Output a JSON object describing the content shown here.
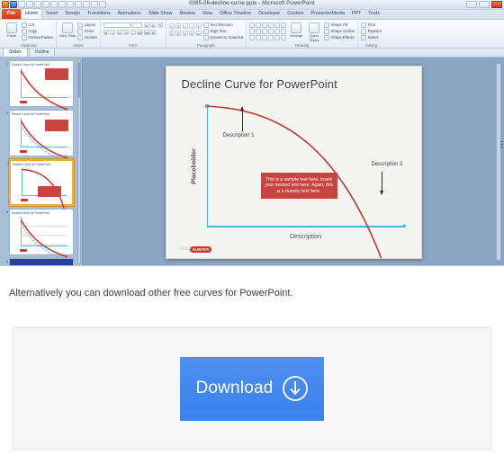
{
  "app": {
    "title": "0085-06-decline-curve.pptx - Microsoft PowerPoint",
    "quick_access": [
      "save-icon",
      "undo-icon",
      "redo-icon",
      "new-icon",
      "open-icon",
      "print-icon",
      "customize-icon"
    ],
    "window_buttons": [
      "minimize-button",
      "restore-button",
      "close-button"
    ]
  },
  "ribbon": {
    "tabs": [
      {
        "label": "File",
        "type": "file"
      },
      {
        "label": "Home",
        "type": "active"
      },
      {
        "label": "Insert",
        "type": "normal"
      },
      {
        "label": "Design",
        "type": "normal"
      },
      {
        "label": "Transitions",
        "type": "normal"
      },
      {
        "label": "Animations",
        "type": "normal"
      },
      {
        "label": "Slide Show",
        "type": "normal"
      },
      {
        "label": "Review",
        "type": "normal"
      },
      {
        "label": "View",
        "type": "normal"
      },
      {
        "label": "Office Timeline",
        "type": "normal"
      },
      {
        "label": "Developer",
        "type": "normal"
      },
      {
        "label": "Custom",
        "type": "normal"
      },
      {
        "label": "PresenterMedia",
        "type": "normal"
      },
      {
        "label": "PPT",
        "type": "normal"
      },
      {
        "label": "Tools",
        "type": "normal"
      }
    ],
    "groups": {
      "clipboard": {
        "label": "Clipboard",
        "paste": "Paste",
        "items": [
          "Cut",
          "Copy",
          "Format Painter"
        ]
      },
      "slides": {
        "label": "Slides",
        "new_slide": "New Slide",
        "items": [
          "Layout",
          "Reset",
          "Section"
        ]
      },
      "font": {
        "label": "Font",
        "font_name": "",
        "font_size": "",
        "buttons": [
          "B",
          "I",
          "U",
          "S",
          "AV",
          "Aa",
          "A"
        ]
      },
      "paragraph": {
        "label": "Paragraph",
        "items": [
          "Text Direction",
          "Align Text",
          "Convert to SmartArt"
        ]
      },
      "drawing": {
        "label": "Drawing",
        "arrange": "Arrange",
        "quick_styles": "Quick Styles",
        "items": [
          "Shape Fill",
          "Shape Outline",
          "Shape Effects"
        ]
      },
      "editing": {
        "label": "Editing",
        "items": [
          "Find",
          "Replace",
          "Select"
        ]
      }
    }
  },
  "pane_tabs": [
    {
      "label": "Slides",
      "active": true
    },
    {
      "label": "Outline",
      "active": false
    }
  ],
  "thumbnails": [
    {
      "number": "1",
      "title": "Decline Curve for PowerPoint",
      "selected": false
    },
    {
      "number": "2",
      "title": "Decline Curve for PowerPoint",
      "selected": false
    },
    {
      "number": "3",
      "title": "Decline Curve for PowerPoint",
      "selected": true
    },
    {
      "number": "4",
      "title": "Decline Curve for PowerPoint",
      "selected": false
    },
    {
      "number": "5",
      "title": "",
      "selected": false
    }
  ],
  "slide": {
    "title": "Decline Curve for PowerPoint",
    "y_axis_label": "Placeholder",
    "x_axis_label": "Description",
    "annotation_1": "Description 1",
    "annotation_2": "Description 2",
    "text_box": "This is a sample text here. Insert your desired text here. Again, this is a dummy text here.",
    "logo_word": "Slide",
    "logo_badge": "HUNTER",
    "colors": {
      "axis": "#49b6dd",
      "curve": "#c0392b",
      "textbox": "#c8453f",
      "title_text": "#3f4548"
    }
  },
  "chart_data": {
    "type": "line",
    "title": "Decline Curve for PowerPoint",
    "xlabel": "Description",
    "ylabel": "Placeholder",
    "x": [
      0,
      10,
      20,
      30,
      40,
      50,
      60,
      70,
      80,
      90,
      100
    ],
    "values": [
      100,
      99.5,
      98,
      95.4,
      91.6,
      86.6,
      80,
      71.4,
      60,
      43.6,
      0
    ],
    "xlim": [
      0,
      100
    ],
    "ylim": [
      0,
      100
    ],
    "grid": false,
    "legend": "none",
    "annotations": [
      {
        "text": "Description 1",
        "x": 14,
        "y": 97,
        "arrow": "up"
      },
      {
        "text": "Description 2",
        "x": 78,
        "y": 55,
        "arrow": "down"
      }
    ],
    "series": [
      {
        "name": "Decline Curve",
        "color": "#c0392b",
        "values": [
          100,
          99.5,
          98,
          95.4,
          91.6,
          86.6,
          80,
          71.4,
          60,
          43.6,
          0
        ]
      }
    ]
  },
  "page": {
    "paragraph": "Alternatively you can download other free curves for PowerPoint.",
    "download_label": "Download",
    "download_color": "#4287ee"
  }
}
